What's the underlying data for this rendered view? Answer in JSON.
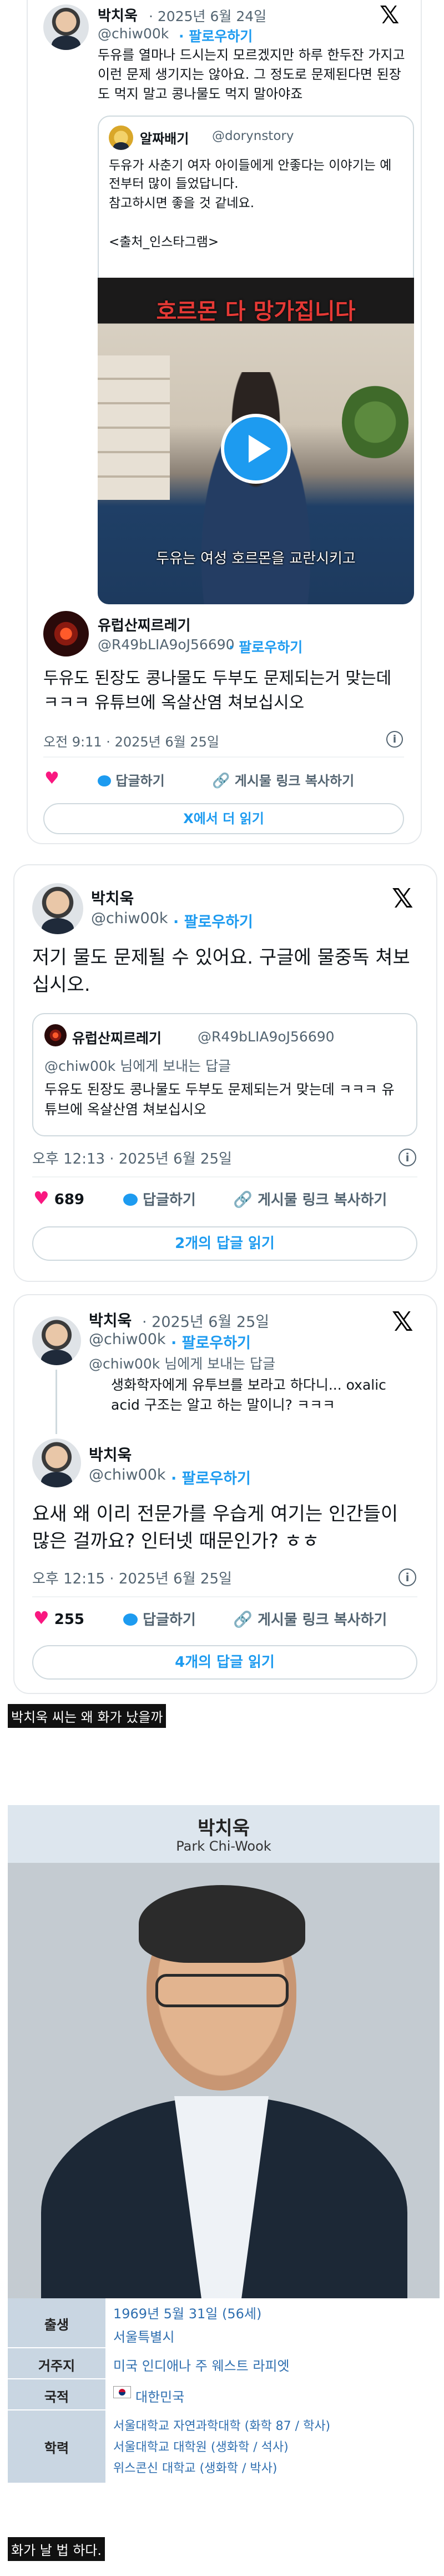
{
  "post1": {
    "author": "박치욱",
    "date": "· 2025년 6월 24일",
    "handle": "@chiw00k",
    "follow": "· 팔로우하기",
    "text": "두유를 열마나 드시는지 모르겠지만 하루 한두잔 가지고 이런 문제 생기지는 않아요. 그 정도로 문제된다면 된장도 먹지 말고 콩나물도 먹지 말아야죠",
    "quote": {
      "author": "알짜배기",
      "handle": "@dorynstory",
      "text_l1": "두유가 사춘기 여자 아이들에게 안좋다는 이야기는 예전부터 많이 들었답니다.",
      "text_l2": "참고하시면 좋을 것 같네요.",
      "text_l3": "<출처_인스타그램>",
      "video_top": "호르몬 다 망가집니다",
      "video_subtitle": "두유는 여성 호르몬을 교란시키고"
    },
    "reply": {
      "author": "유럽산찌르레기",
      "handle": "@R49bLIA9oJ56690",
      "follow": "· 팔로우하기",
      "text": "두유도 된장도 콩나물도 두부도 문제되는거 맞는데 ㅋㅋㅋ 유튜브에 옥살산염 쳐보십시오",
      "time": "오전 9:11 · 2025년 6월 25일",
      "reply_label": "답글하기",
      "copy_label": "게시물 링크 복사하기",
      "read_more": "X에서 더 읽기"
    }
  },
  "post2": {
    "author": "박치욱",
    "handle": "@chiw00k",
    "follow": "· 팔로우하기",
    "text": "저기 물도 문제될 수 있어요. 구글에 물중독 쳐보십시오.",
    "quote": {
      "author": "유럽산찌르레기",
      "handle": "@R49bLIA9oJ56690",
      "reply_to": "@chiw00k 님에게 보내는 답글",
      "text": "두유도 된장도 콩나물도 두부도 문제되는거 맞는데 ㅋㅋㅋ 유튜브에 옥살산염 쳐보십시오"
    },
    "time": "오후 12:13 · 2025년 6월 25일",
    "likes": "689",
    "reply_label": "답글하기",
    "copy_label": "게시물 링크 복사하기",
    "read_replies": "2개의 답글 읽기"
  },
  "post3": {
    "parent": {
      "author": "박치욱",
      "date": "· 2025년 6월 25일",
      "handle": "@chiw00k",
      "follow": "· 팔로우하기",
      "reply_to": "@chiw00k 님에게 보내는 답글",
      "text": "생화학자에게 유투브를 보라고 하다니... oxalic acid 구조는 알고 하는 말이니? ㅋㅋㅋ"
    },
    "author": "박치욱",
    "handle": "@chiw00k",
    "follow": "· 팔로우하기",
    "text": "요새 왜 이리 전문가를 우습게 여기는 인간들이 많은 걸까요? 인터넷 때문인가? ㅎㅎ",
    "time": "오후 12:15 · 2025년 6월 25일",
    "likes": "255",
    "reply_label": "답글하기",
    "copy_label": "게시물 링크 복사하기",
    "read_replies": "4개의 답글 읽기"
  },
  "caption1": "박치욱 씨는 왜 화가 났을까",
  "profile": {
    "name_ko": "박치욱",
    "name_en": "Park Chi-Wook",
    "rows": [
      {
        "label": "출생",
        "value": "1969년 5월 31일 (56세)",
        "value2": "서울특별시"
      },
      {
        "label": "거주지",
        "value": "미국 인디애나 주 웨스트 라피엣"
      },
      {
        "label": "국적",
        "value": "대한민국"
      },
      {
        "label": "학력",
        "value": "서울대학교 자연과학대학 (화학 87 / 학사)",
        "value2": "서울대학교 대학원 (생화학 / 석사)",
        "value3": "위스콘신 대학교 (생화학 / 박사)"
      }
    ]
  },
  "caption2": "화가 날 법 하다.",
  "colors": {
    "accent": "#1d9bf0",
    "heart": "#f91880",
    "infobox_header": "#dde6ee",
    "infobox_label": "#c9d6e2"
  }
}
